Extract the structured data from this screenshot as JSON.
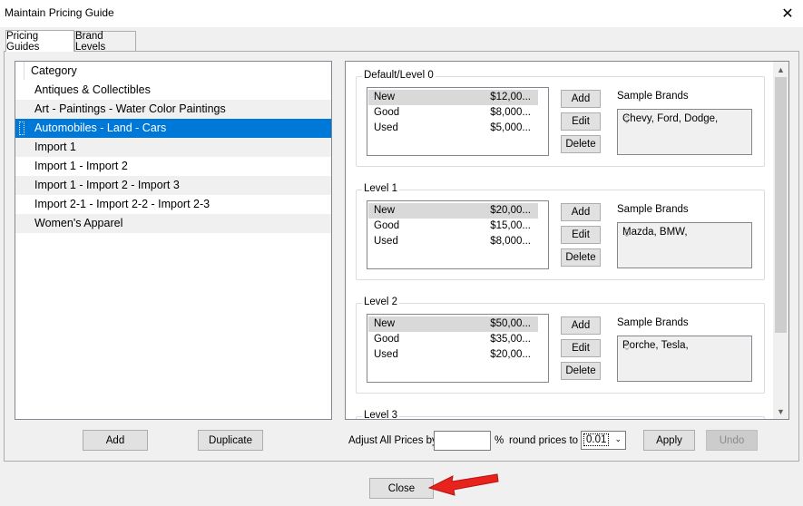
{
  "window": {
    "title": "Maintain Pricing Guide"
  },
  "tabs": [
    {
      "label": "Pricing Guides"
    },
    {
      "label": "Brand Levels"
    }
  ],
  "categories": {
    "header": "Category",
    "items": [
      "Antiques & Collectibles",
      "Art - Paintings - Water Color Paintings",
      "Automobiles - Land - Cars",
      "Import 1",
      "Import 1 - Import 2",
      "Import 1 - Import 2 - Import 3",
      "Import 2-1 - Import 2-2 - Import 2-3",
      "Women's Apparel"
    ],
    "selected_index": 2,
    "add_label": "Add",
    "duplicate_label": "Duplicate"
  },
  "levels": [
    {
      "title": "Default/Level 0",
      "rows": [
        {
          "name": "New",
          "price": "$12,00..."
        },
        {
          "name": "Good",
          "price": "$8,000..."
        },
        {
          "name": "Used",
          "price": "$5,000..."
        }
      ],
      "sample_brands_label": "Sample Brands",
      "sample_brands": "Chevy, Ford, Dodge,"
    },
    {
      "title": "Level 1",
      "rows": [
        {
          "name": "New",
          "price": "$20,00..."
        },
        {
          "name": "Good",
          "price": "$15,00..."
        },
        {
          "name": "Used",
          "price": "$8,000..."
        }
      ],
      "sample_brands_label": "Sample Brands",
      "sample_brands": "Mazda, BMW,"
    },
    {
      "title": "Level 2",
      "rows": [
        {
          "name": "New",
          "price": "$50,00..."
        },
        {
          "name": "Good",
          "price": "$35,00..."
        },
        {
          "name": "Used",
          "price": "$20,00..."
        }
      ],
      "sample_brands_label": "Sample Brands",
      "sample_brands": "Porche, Tesla,"
    },
    {
      "title": "Level 3"
    }
  ],
  "level_buttons": {
    "add": "Add",
    "edit": "Edit",
    "delete": "Delete"
  },
  "adjust": {
    "prefix": "Adjust All Prices by",
    "value": "",
    "percent": "%",
    "round_label": "round prices to",
    "round_value": "0.01",
    "apply_label": "Apply",
    "undo_label": "Undo"
  },
  "footer": {
    "close_label": "Close"
  },
  "colors": {
    "selection": "#0078d7",
    "arrow": "#e8231d"
  },
  "icons": {
    "window_close": "close-icon",
    "scroll_up": "chevron-up-icon",
    "scroll_down": "chevron-down-icon",
    "dropdown": "chevron-down-icon",
    "annotation": "red-arrow-icon"
  }
}
